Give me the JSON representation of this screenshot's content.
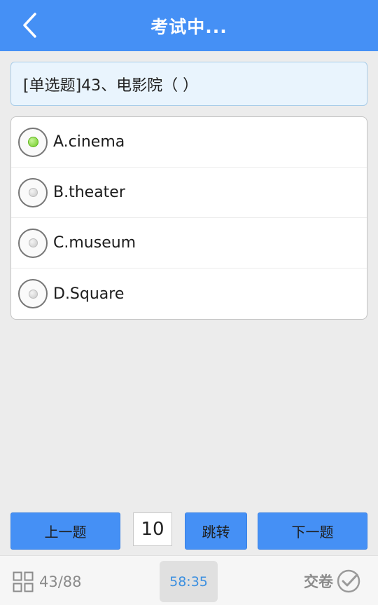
{
  "header": {
    "title": "考试中..."
  },
  "question": {
    "text": "[单选题]43、电影院（ ）"
  },
  "options": [
    {
      "label": "A.cinema",
      "selected": true
    },
    {
      "label": "B.theater",
      "selected": false
    },
    {
      "label": "C.museum",
      "selected": false
    },
    {
      "label": "D.Square",
      "selected": false
    }
  ],
  "nav": {
    "prev_label": "上一题",
    "page_value": "10",
    "jump_label": "跳转",
    "next_label": "下一题"
  },
  "footer": {
    "progress": "43/88",
    "timer": "58:35",
    "submit_label": "交卷"
  },
  "colors": {
    "accent": "#4590f5",
    "selected_dot": "#6ecb23",
    "timer_text": "#3b8fe0"
  }
}
